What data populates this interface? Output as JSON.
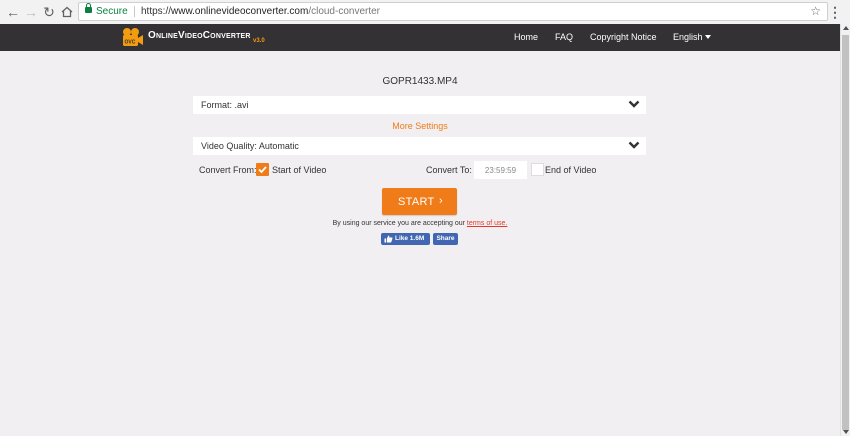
{
  "browser": {
    "secure_label": "Secure",
    "url_scheme": "https://",
    "url_host": "www.onlinevideoconverter.com",
    "url_path": "/cloud-converter"
  },
  "site": {
    "logo_text": "OnlineVideoConverter",
    "logo_version": "v3.0",
    "logo_badge": "OVC",
    "nav": {
      "home": "Home",
      "faq": "FAQ",
      "copyright": "Copyright Notice",
      "language": "English"
    }
  },
  "converter": {
    "filename": "GOPR1433.MP4",
    "format_label": "Format: .avi",
    "more_settings": "More Settings",
    "quality_label": "Video Quality: Automatic",
    "convert_from_label": "Convert From:",
    "start_of_video": "Start of Video",
    "start_checked": true,
    "convert_to_label": "Convert To:",
    "convert_to_value": "23:59:59",
    "end_of_video": "End of Video",
    "end_checked": false,
    "start_button": "START",
    "start_arrow": "›",
    "terms_prefix": "By using our service you are accepting our ",
    "terms_link": "terms of use."
  },
  "social": {
    "like_label": "Like 1.6M",
    "share_label": "Share"
  },
  "colors": {
    "accent": "#f07c19",
    "header_bg": "#333133",
    "page_bg": "#f1eff1",
    "facebook": "#4267b2",
    "terms_link": "#e03b2c"
  }
}
